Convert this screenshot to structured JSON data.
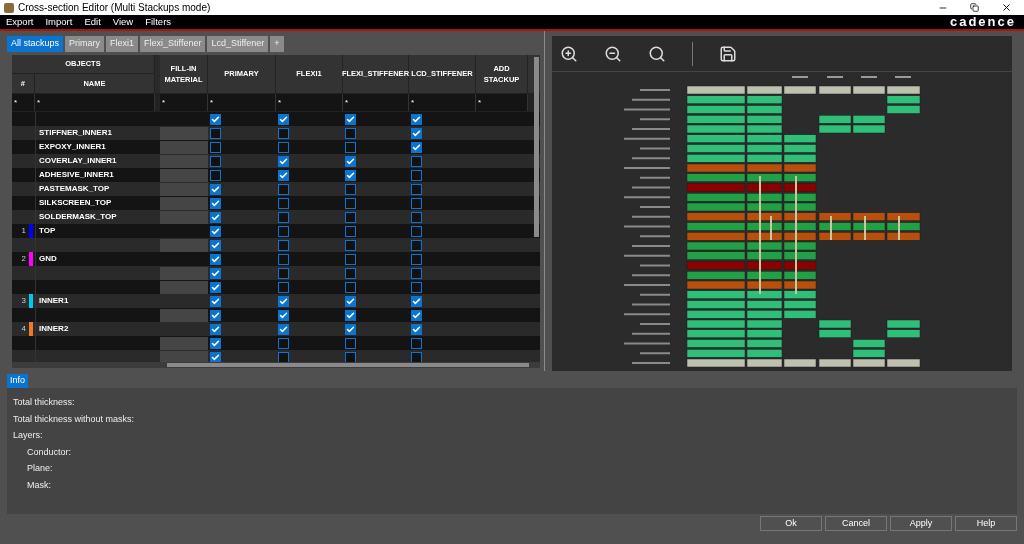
{
  "window": {
    "title": "Cross-section Editor (Multi Stackups mode)"
  },
  "menu": [
    "Export",
    "Import",
    "Edit",
    "View",
    "Filters"
  ],
  "logo": "cadence",
  "tabs": [
    {
      "label": "All stackups",
      "selected": true
    },
    {
      "label": "Primary",
      "selected": false
    },
    {
      "label": "Flexi1",
      "selected": false
    },
    {
      "label": "Flexi_Stiffener",
      "selected": false
    },
    {
      "label": "Lcd_Stiffener",
      "selected": false
    },
    {
      "label": "+",
      "selected": false
    }
  ],
  "table": {
    "group_header": "OBJECTS",
    "columns": [
      "#",
      "NAME",
      "FILL-IN MATERIAL",
      "PRIMARY",
      "FLEXI1",
      "FLEXI_STIFFENER",
      "LCD_STIFFENER",
      "ADD STACKUP"
    ],
    "filters": [
      "*",
      "*",
      "*",
      "*",
      "*",
      "*",
      "*",
      "*"
    ],
    "rows": [
      {
        "kind": "surface",
        "stackups": [
          {
            "checked": true
          },
          {
            "checked": true
          },
          {
            "checked": true
          },
          {
            "checked": true
          }
        ]
      },
      {
        "kind": "mask",
        "name": "STIFFNER_INNER1",
        "stackups": [
          {
            "checked": false
          },
          {
            "checked": false
          },
          {
            "checked": false
          },
          {
            "checked": true
          }
        ]
      },
      {
        "kind": "mask",
        "name": "EXPOXY_INNER1",
        "stackups": [
          {
            "checked": false
          },
          {
            "checked": false
          },
          {
            "checked": false
          },
          {
            "checked": true
          }
        ]
      },
      {
        "kind": "mask",
        "name": "COVERLAY_INNER1",
        "stackups": [
          {
            "checked": false
          },
          {
            "checked": true
          },
          {
            "checked": true
          },
          {
            "checked": false
          }
        ]
      },
      {
        "kind": "mask",
        "name": "ADHESIVE_INNER1",
        "stackups": [
          {
            "checked": false
          },
          {
            "checked": true
          },
          {
            "checked": true
          },
          {
            "checked": false
          }
        ]
      },
      {
        "kind": "mask",
        "name": "PASTEMASK_TOP",
        "stackups": [
          {
            "checked": true
          },
          {
            "checked": false
          },
          {
            "checked": false
          },
          {
            "checked": false
          }
        ]
      },
      {
        "kind": "mask",
        "name": "SILKSCREEN_TOP",
        "stackups": [
          {
            "checked": true
          },
          {
            "checked": false
          },
          {
            "checked": false
          },
          {
            "checked": false
          }
        ]
      },
      {
        "kind": "mask",
        "name": "SOLDERMASK_TOP",
        "stackups": [
          {
            "checked": true
          },
          {
            "checked": false
          },
          {
            "checked": false
          },
          {
            "checked": false
          }
        ]
      },
      {
        "kind": "conductor",
        "number": "1",
        "name": "TOP",
        "color": "#0000ff",
        "stackups": [
          {
            "checked": true
          },
          {
            "checked": false
          },
          {
            "checked": false
          },
          {
            "checked": false
          }
        ]
      },
      {
        "kind": "dielectric",
        "stackups": [
          {
            "checked": true
          },
          {
            "checked": false
          },
          {
            "checked": false
          },
          {
            "checked": false
          }
        ]
      },
      {
        "kind": "conductor",
        "number": "2",
        "name": "GND",
        "color": "#ff00ff",
        "stackups": [
          {
            "checked": true
          },
          {
            "checked": false
          },
          {
            "checked": false
          },
          {
            "checked": false
          }
        ]
      },
      {
        "kind": "dielectric",
        "stackups": [
          {
            "checked": true
          },
          {
            "checked": false
          },
          {
            "checked": false
          },
          {
            "checked": false
          }
        ]
      },
      {
        "kind": "dielectric",
        "stackups": [
          {
            "checked": true
          },
          {
            "checked": false
          },
          {
            "checked": false
          },
          {
            "checked": false
          }
        ]
      },
      {
        "kind": "conductor",
        "number": "3",
        "name": "INNER1",
        "color": "#00c8f0",
        "stackups": [
          {
            "checked": true
          },
          {
            "checked": true
          },
          {
            "checked": true
          },
          {
            "checked": true
          }
        ]
      },
      {
        "kind": "dielectric",
        "stackups": [
          {
            "checked": true
          },
          {
            "checked": true
          },
          {
            "checked": true
          },
          {
            "checked": true
          }
        ]
      },
      {
        "kind": "conductor",
        "number": "4",
        "name": "INNER2",
        "color": "#f07828",
        "stackups": [
          {
            "checked": true
          },
          {
            "checked": true
          },
          {
            "checked": true
          },
          {
            "checked": true
          }
        ]
      },
      {
        "kind": "dielectric",
        "stackups": [
          {
            "checked": true
          },
          {
            "checked": false
          },
          {
            "checked": false
          },
          {
            "checked": false
          }
        ]
      },
      {
        "kind": "dielectric",
        "stackups": [
          {
            "checked": true
          },
          {
            "checked": false
          },
          {
            "checked": false
          },
          {
            "checked": false
          }
        ]
      }
    ]
  },
  "info": {
    "tab": {
      "label": "Info",
      "selected": true
    },
    "lines": [
      {
        "label": "Total thickness:"
      },
      {
        "label": "Total thickness without masks:"
      },
      {
        "label": "Layers:",
        "children": [
          {
            "label": "Conductor:"
          },
          {
            "label": "Plane:"
          },
          {
            "label": "Mask:"
          }
        ]
      }
    ]
  },
  "buttons": [
    "Ok",
    "Cancel",
    "Apply",
    "Help"
  ]
}
